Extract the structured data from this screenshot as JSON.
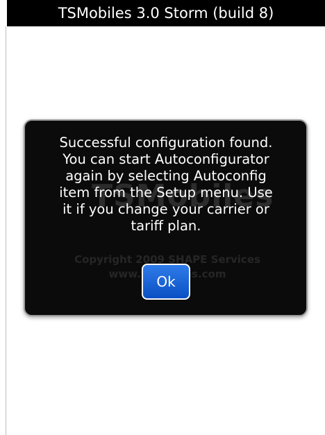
{
  "title_bar": {
    "title": "TSMobiles 3.0 Storm (build 8)"
  },
  "background": {
    "logo_text": "TSMobiles",
    "copyright": "Copyright 2009 SHAPE Services",
    "url": "www.tsmobiles.com"
  },
  "dialog": {
    "message": "Successful configuration found.\nYou can start Autoconfigurator\nagain by selecting Autoconfig\nitem from the Setup menu. Use\nit if you change your carrier or\ntariff plan.",
    "ok_label": "Ok"
  },
  "colors": {
    "title_bar_bg": "#000000",
    "dialog_bg": "#0b0b0b",
    "button_accent": "#1a64d8"
  }
}
